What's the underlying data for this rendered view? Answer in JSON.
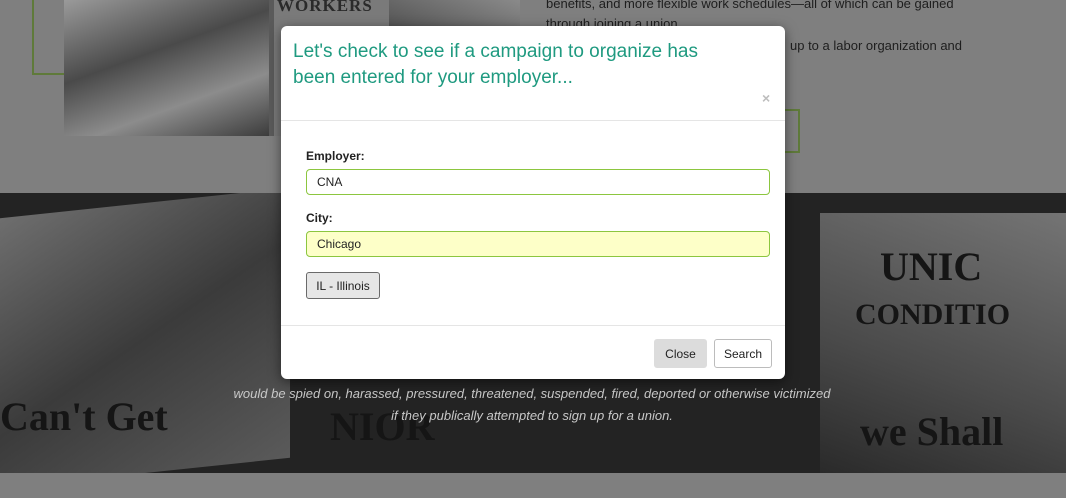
{
  "background": {
    "photo_sign_text": "WORKERS",
    "top_paragraph_line1": "benefits, and more flexible work schedules—all of which can be gained",
    "top_paragraph_line2": "through joining a union.",
    "top_paragraph_line3": "up to a labor organization and",
    "band_words": [
      "UNIC",
      "CONDITIO",
      "Can't Get",
      "NIOR",
      "we Shall"
    ],
    "band_text_line1": "would be spied on, harassed, pressured, threatened, suspended, fired, deported or otherwise victimized",
    "band_text_line2": "if they publically attempted to sign up for a union."
  },
  "modal": {
    "title": "Let's check to see if a campaign to organize has been entered for your employer...",
    "close_x": "×",
    "employer_label": "Employer:",
    "employer_value": "CNA",
    "city_label": "City:",
    "city_value": "Chicago",
    "state_button": "IL - Illinois",
    "close_button": "Close",
    "search_button": "Search"
  },
  "colors": {
    "title": "#1f9a80",
    "input_border": "#8cc63f",
    "city_bg": "#fdffc8"
  }
}
